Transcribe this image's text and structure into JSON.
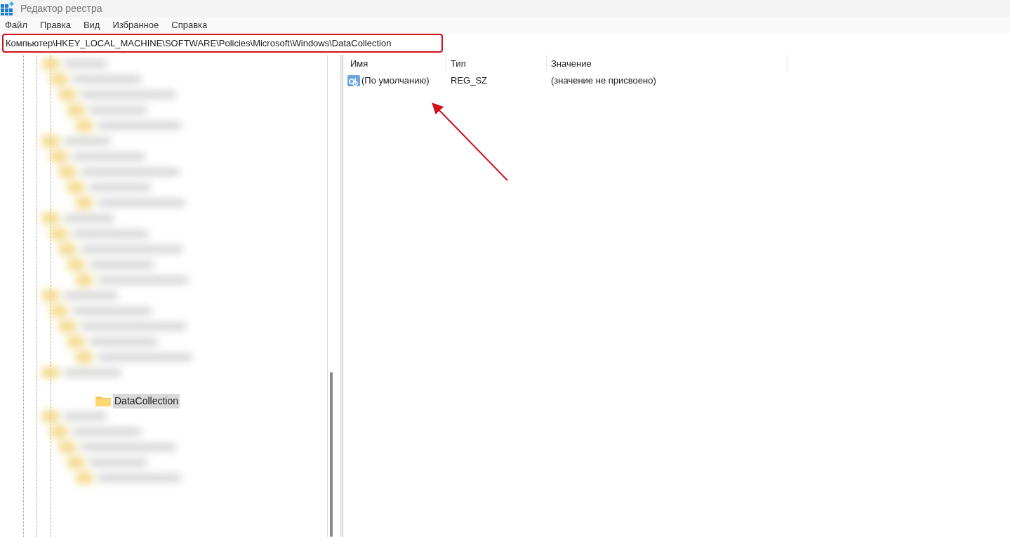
{
  "window": {
    "title": "Редактор реестра"
  },
  "menu": [
    "Файл",
    "Правка",
    "Вид",
    "Избранное",
    "Справка"
  ],
  "address": {
    "path": "Компьютер\\HKEY_LOCAL_MACHINE\\SOFTWARE\\Policies\\Microsoft\\Windows\\DataCollection",
    "highlighted": true
  },
  "tree": {
    "items": [
      {
        "label": "DataCollection",
        "selected": true
      }
    ]
  },
  "list": {
    "columns": [
      "Имя",
      "Тип",
      "Значение"
    ],
    "rows": [
      {
        "name": "(По умолчанию)",
        "type": "REG_SZ",
        "value": "(значение не присвоено)",
        "kind": "string"
      }
    ]
  },
  "annotation": {
    "arrow": true
  }
}
